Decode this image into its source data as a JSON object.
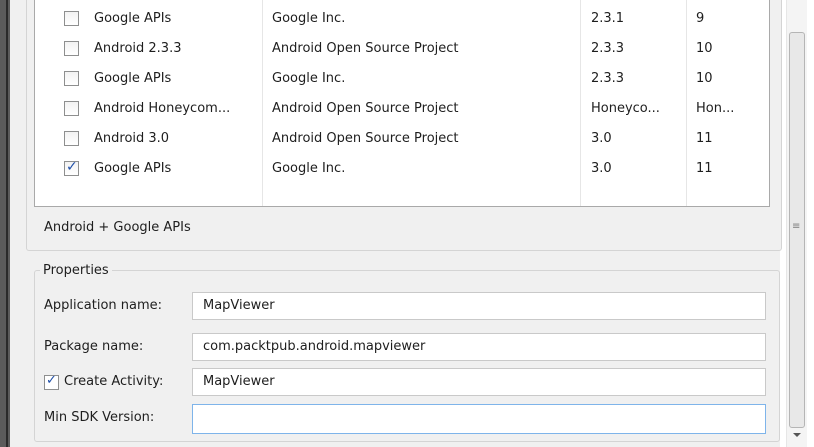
{
  "targets": [
    {
      "checked": false,
      "name": "Google APIs",
      "vendor": "Google Inc.",
      "platform": "2.3.1",
      "api": "9"
    },
    {
      "checked": false,
      "name": "Android 2.3.3",
      "vendor": "Android Open Source Project",
      "platform": "2.3.3",
      "api": "10"
    },
    {
      "checked": false,
      "name": "Google APIs",
      "vendor": "Google Inc.",
      "platform": "2.3.3",
      "api": "10"
    },
    {
      "checked": false,
      "name": "Android Honeycom...",
      "vendor": "Android Open Source Project",
      "platform": "Honeyco...",
      "api": "Hon..."
    },
    {
      "checked": false,
      "name": "Android 3.0",
      "vendor": "Android Open Source Project",
      "platform": "3.0",
      "api": "11"
    },
    {
      "checked": true,
      "name": "Google APIs",
      "vendor": "Google Inc.",
      "platform": "3.0",
      "api": "11"
    }
  ],
  "target_description": "Android + Google APIs",
  "properties": {
    "legend": "Properties",
    "app_name_label": "Application name:",
    "app_name_value": "MapViewer",
    "package_label": "Package name:",
    "package_value": "com.packtpub.android.mapviewer",
    "create_activity_label": "Create Activity:",
    "create_activity_checked": true,
    "create_activity_value": "MapViewer",
    "min_sdk_label": "Min SDK Version:",
    "min_sdk_value": ""
  }
}
